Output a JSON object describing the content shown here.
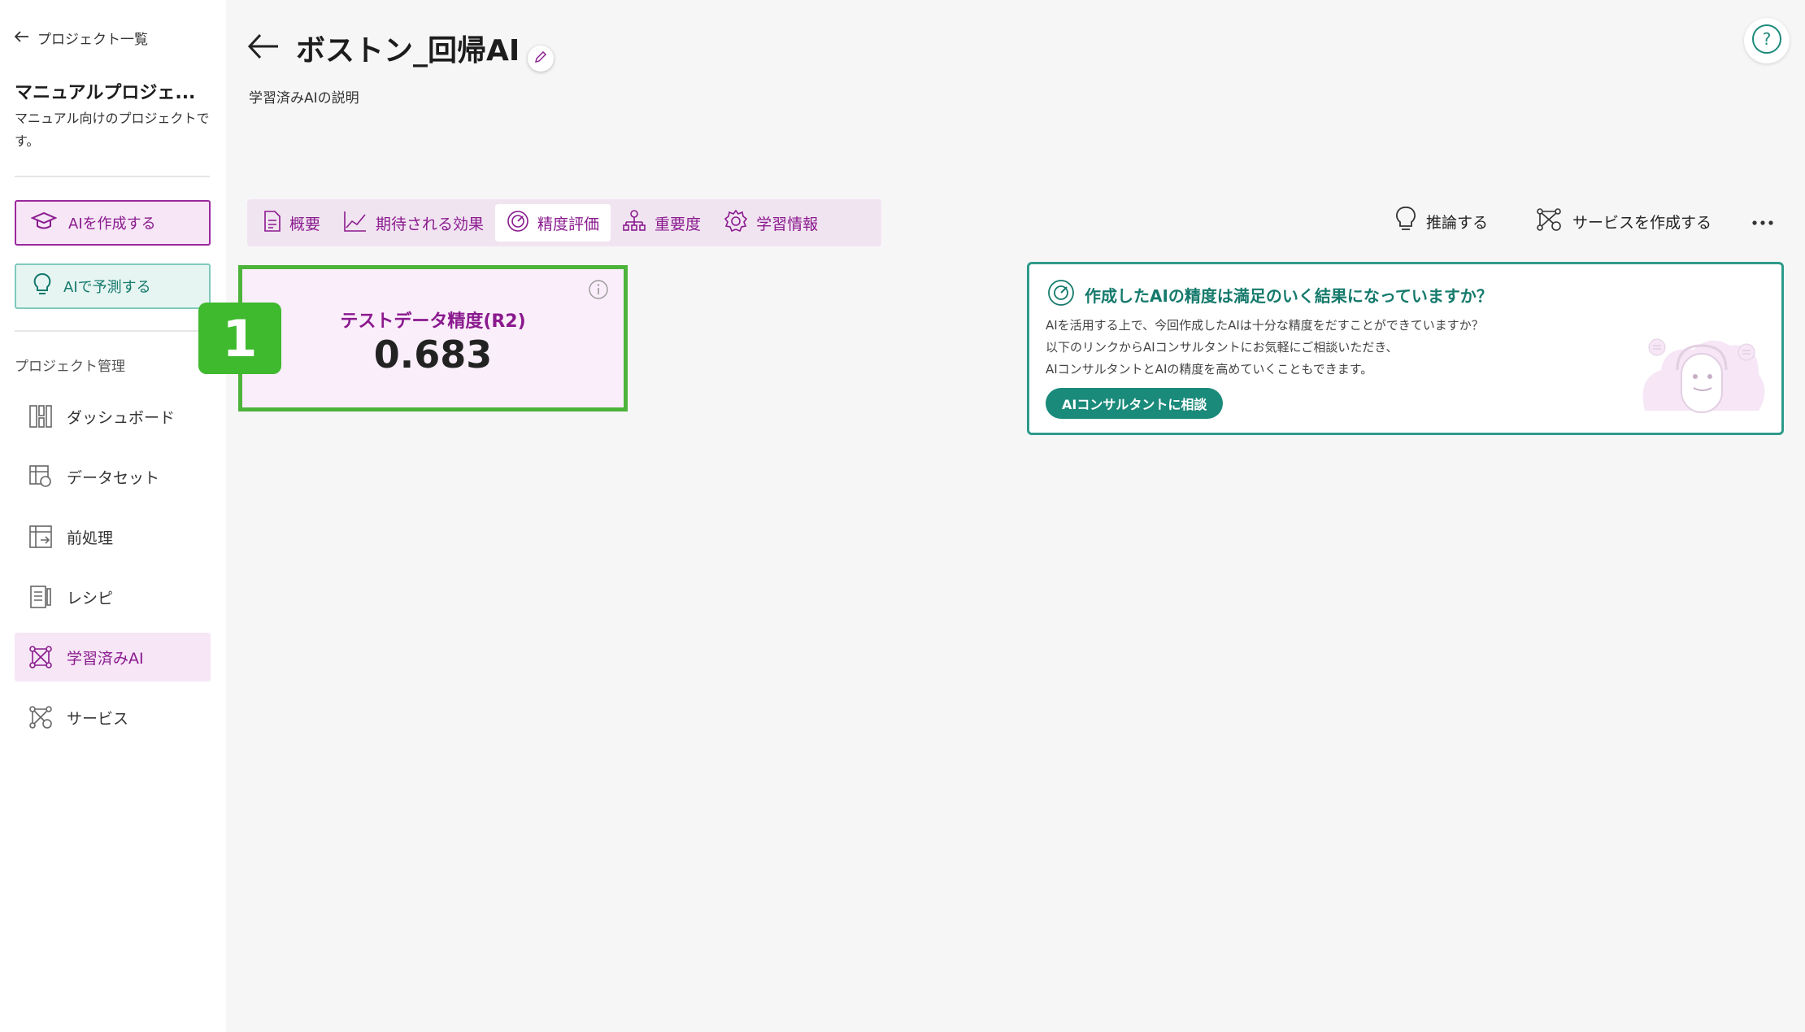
{
  "sidebar": {
    "back_label": "プロジェクト一覧",
    "project_title": "マニュアルプロジェ...",
    "project_description": "マニュアル向けのプロジェクトです。",
    "create_ai_label": "AIを作成する",
    "predict_ai_label": "AIで予測する",
    "section_label": "プロジェクト管理",
    "items": [
      {
        "label": "ダッシュボード",
        "icon": "dashboard-icon"
      },
      {
        "label": "データセット",
        "icon": "dataset-icon"
      },
      {
        "label": "前処理",
        "icon": "preprocess-icon"
      },
      {
        "label": "レシピ",
        "icon": "recipe-icon"
      },
      {
        "label": "学習済みAI",
        "icon": "trained-ai-icon",
        "active": true
      },
      {
        "label": "サービス",
        "icon": "service-icon"
      }
    ]
  },
  "header": {
    "title": "ボストン_回帰AI",
    "subtitle": "学習済みAIの説明"
  },
  "tabs": [
    {
      "label": "概要",
      "icon": "document-icon"
    },
    {
      "label": "期待される効果",
      "icon": "line-chart-icon"
    },
    {
      "label": "精度評価",
      "icon": "gauge-icon",
      "active": true
    },
    {
      "label": "重要度",
      "icon": "hierarchy-icon"
    },
    {
      "label": "学習情報",
      "icon": "gear-icon"
    }
  ],
  "actions": {
    "infer_label": "推論する",
    "create_service_label": "サービスを作成する"
  },
  "metric": {
    "label": "テストデータ精度(R2)",
    "value": "0.683"
  },
  "annotation_marker": "1",
  "consult": {
    "title": "作成したAIの精度は満足のいく結果になっていますか？",
    "line1": "AIを活用する上で、今回作成したAIは十分な精度をだすことができていますか？",
    "line2": "以下のリンクからAIコンサルタントにお気軽にご相談いただき、",
    "line3": "AIコンサルタントとAIの精度を高めていくこともできます。",
    "button_label": "AIコンサルタントに相談"
  },
  "colors": {
    "accent": "#8a1a8e",
    "teal": "#1a8a7a",
    "highlight": "#4cb43a"
  }
}
